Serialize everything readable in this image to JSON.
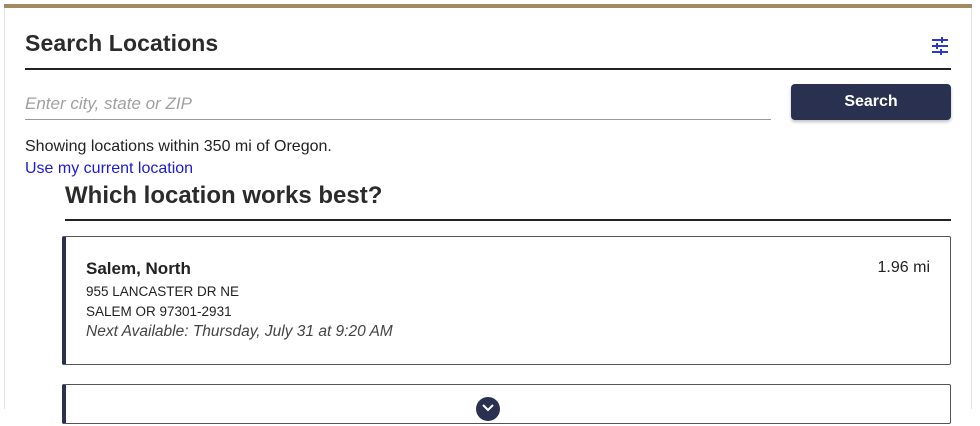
{
  "header": {
    "title": "Search Locations",
    "filter_icon": "sliders-icon"
  },
  "search": {
    "placeholder": "Enter city, state or ZIP",
    "value": "",
    "button_label": "Search"
  },
  "status": {
    "showing_text": "Showing locations within 350 mi of Oregon.",
    "use_location_link": "Use my current location"
  },
  "results": {
    "heading": "Which location works best?",
    "items": [
      {
        "name": "Salem, North",
        "distance": "1.96 mi",
        "address_line1": "955 LANCASTER DR NE",
        "address_line2": "SALEM OR 97301-2931",
        "next_available": "Next Available: Thursday, July 31 at 9:20 AM"
      }
    ]
  },
  "colors": {
    "accent_bar": "#a28b62",
    "primary": "#2a3150",
    "link": "#1a1ad8"
  }
}
